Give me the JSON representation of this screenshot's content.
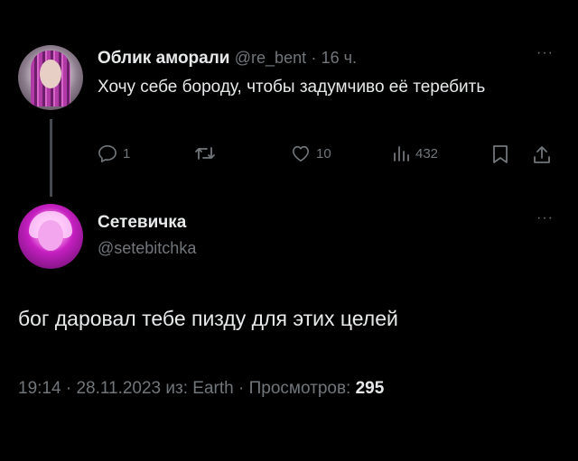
{
  "parent_tweet": {
    "display_name": "Облик аморали",
    "handle": "@re_bent",
    "separator": "·",
    "time_ago": "16 ч.",
    "text": "Хочу себе бороду, чтобы задумчиво её теребить",
    "actions": {
      "replies": "1",
      "retweets": "",
      "likes": "10",
      "views": "432"
    },
    "icons": [
      "reply-icon",
      "retweet-icon",
      "like-icon",
      "views-icon",
      "bookmark-icon",
      "share-icon",
      "more-icon"
    ]
  },
  "reply_tweet": {
    "display_name": "Сетевичка",
    "handle": "@setebitchka",
    "text": "бог даровал тебе пизду для этих целей",
    "meta": {
      "time": "19:14",
      "date": "28.11.2023",
      "source_prefix": "из:",
      "source": "Earth",
      "views_label": "Просмотров:",
      "views": "295",
      "separator": "·"
    }
  },
  "more_glyph": "···",
  "colors": {
    "background": "#000000",
    "text": "#e7e9ea",
    "muted": "#71767b",
    "thread_line": "#444a4f"
  }
}
